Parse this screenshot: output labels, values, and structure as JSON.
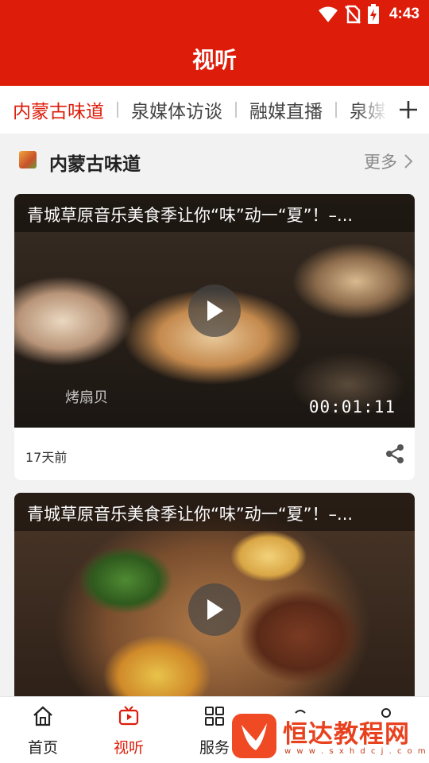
{
  "status_bar": {
    "time": "4:43",
    "icons": [
      "wifi-icon",
      "no-sim-icon",
      "battery-icon"
    ]
  },
  "header": {
    "title": "视听"
  },
  "channels": {
    "tabs": [
      {
        "label": "内蒙古味道",
        "active": true
      },
      {
        "label": "泉媒体访谈",
        "active": false
      },
      {
        "label": "融媒直播",
        "active": false
      },
      {
        "label": "泉媒",
        "active": false
      }
    ],
    "add_icon": "plus-icon"
  },
  "section": {
    "title": "内蒙古味道",
    "more_label": "更多"
  },
  "videos": [
    {
      "title": "青城草原音乐美食季让你“味”动一“夏”！–...",
      "duration": "00:01:11",
      "overlay_text": "烤扇贝",
      "time": "17天前"
    },
    {
      "title": "青城草原音乐美食季让你“味”动一“夏”！–..."
    }
  ],
  "bottom_nav": [
    {
      "label": "首页",
      "icon": "home-icon",
      "active": false
    },
    {
      "label": "视听",
      "icon": "tv-icon",
      "active": true
    },
    {
      "label": "服务",
      "icon": "grid-icon",
      "active": false
    },
    {
      "label": "",
      "icon": "tab-icon",
      "active": false
    },
    {
      "label": "",
      "icon": "profile-icon",
      "active": false
    }
  ],
  "watermark": {
    "brand": "恒达教程网",
    "url": "w w w . s x h d c j . c o m"
  },
  "colors": {
    "brand_red": "#dd1c0a",
    "active_text": "#dd1c0a",
    "watermark_orange": "#ef4a23"
  }
}
